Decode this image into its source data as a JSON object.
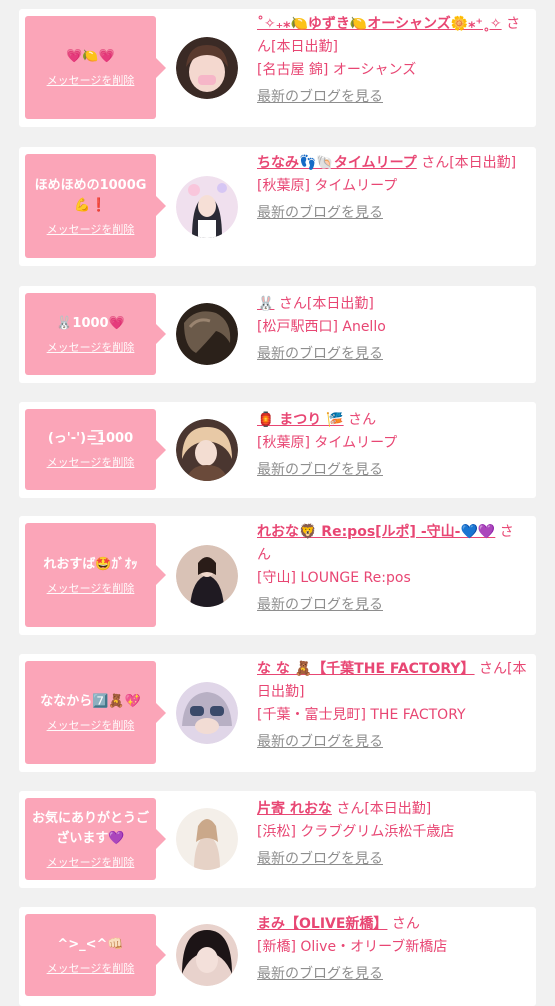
{
  "cards": [
    {
      "message": "💗🍋💗",
      "delete_label": "メッセージを削除",
      "name": "˚✧₊⁎🍋ゆずき🍋オーシャンズ🌼⁎⁺˳✧",
      "suffix": "さん[本日出勤]",
      "location": "[名古屋 錦] オーシャンズ",
      "blog_link": "最新のブログを見る",
      "avatar_colors": [
        "#f2d6d0",
        "#5a3a2e"
      ]
    },
    {
      "message": "ほめほめの1000G💪❗",
      "delete_label": "メッセージを削除",
      "name": "ちなみ👣🐚タイムリープ",
      "suffix": "さん[本日出勤]",
      "location": "[秋葉原] タイムリープ",
      "blog_link": "最新のブログを見る",
      "avatar_colors": [
        "#f3e6f0",
        "#2a2a35"
      ]
    },
    {
      "message": "🐰1000💗",
      "delete_label": "メッセージを削除",
      "name": "🐰",
      "suffix": "さん[本日出勤]",
      "location": "[松戸駅西口] Anello",
      "blog_link": "最新のブログを見る",
      "avatar_colors": [
        "#6b5a4a",
        "#2b211a"
      ]
    },
    {
      "message": "(っ'-')=͟͟͞͞1000",
      "delete_label": "メッセージを削除",
      "name": "🏮 まつり 🎏",
      "suffix": "さん",
      "location": "[秋葉原] タイムリープ",
      "blog_link": "最新のブログを見る",
      "avatar_colors": [
        "#e8c9a6",
        "#6a4a3a"
      ]
    },
    {
      "message": "れおすば🤩ｶﾞｵｯ",
      "delete_label": "メッセージを削除",
      "name": "れおな🦁 Re:pos[ルポ] -守山-💙💜",
      "suffix": "さん",
      "location": "[守山] LOUNGE Re:pos",
      "blog_link": "最新のブログを見る",
      "avatar_colors": [
        "#1f1a22",
        "#d9c2b6"
      ]
    },
    {
      "message": "ななから7️⃣🧸💖",
      "delete_label": "メッセージを削除",
      "name": "な な 🧸【千葉THE FACTORY】",
      "suffix": "さん[本日出勤]",
      "location": "[千葉・富士見町] THE FACTORY",
      "blog_link": "最新のブログを見る",
      "avatar_colors": [
        "#3a4a6a",
        "#e0d6e8"
      ]
    },
    {
      "message": "お気にありがとうございます💜",
      "delete_label": "メッセージを削除",
      "name": "片寄 れおな",
      "suffix": "さん[本日出勤]",
      "location": "[浜松] クラブグリム浜松千歳店",
      "blog_link": "最新のブログを見る",
      "avatar_colors": [
        "#f4efe9",
        "#caa88a"
      ]
    },
    {
      "message": "^>_<^👊🏻",
      "delete_label": "メッセージを削除",
      "name": "まみ【OLIVE新橋】",
      "suffix": "さん",
      "location": "[新橋] Olive・オリーブ新橋店",
      "blog_link": "最新のブログを見る",
      "avatar_colors": [
        "#1c1416",
        "#e8d2cc"
      ]
    }
  ]
}
